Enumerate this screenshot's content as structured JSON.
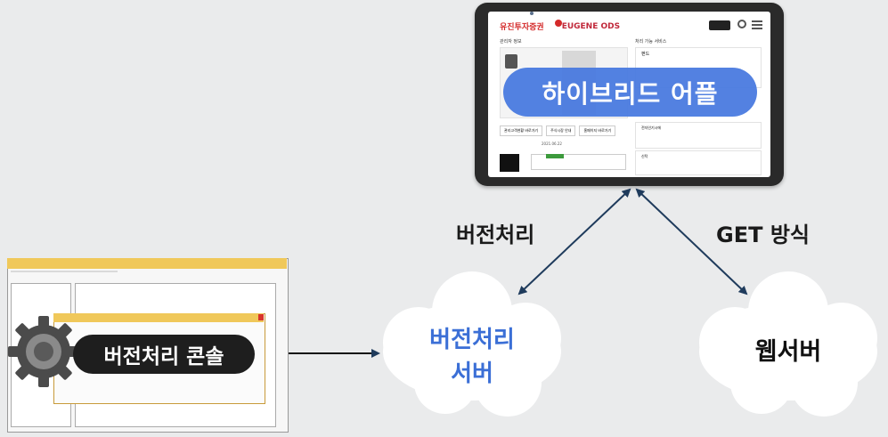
{
  "tablet": {
    "brand_kr": "유진투자증권",
    "brand_en": "EUGENE ODS",
    "left_panel_title": "관리자 정보",
    "right_panel_title": "처리 가능 서비스",
    "buttons": [
      "관리고객현황 바로가기",
      "주식시장 안내",
      "홈페이지 바로가기"
    ],
    "services": [
      "펀드",
      "전자인기시에",
      "신탁"
    ],
    "date": "2021.06.22",
    "overlay_label": "하이브리드 어플"
  },
  "edges": {
    "left_label": "버전처리",
    "right_label": "GET 방식"
  },
  "nodes": {
    "version_server": [
      "버전처리",
      "서버"
    ],
    "web_server": "웹서버",
    "console_label": "버전처리 콘솔"
  },
  "colors": {
    "arrow": "#1f3b5c",
    "server_text": "#3b6fd6",
    "pill": "#4a7be0",
    "brand": "#d42a2a"
  }
}
